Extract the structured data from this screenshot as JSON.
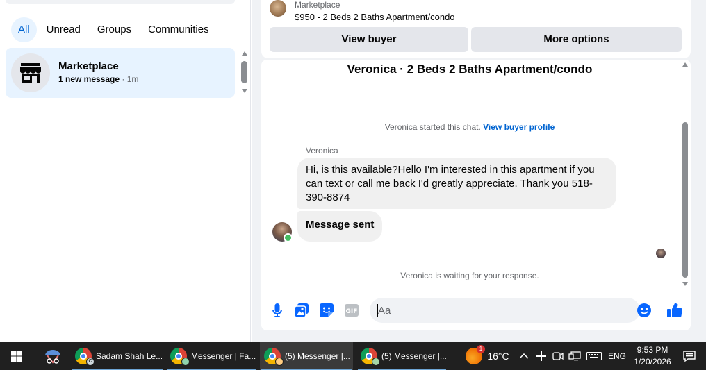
{
  "sidebar": {
    "filters": [
      {
        "label": "All",
        "active": true
      },
      {
        "label": "Unread",
        "active": false
      },
      {
        "label": "Groups",
        "active": false
      },
      {
        "label": "Communities",
        "active": false
      }
    ],
    "chats": [
      {
        "title": "Marketplace",
        "unread": "1 new message",
        "time": " · 1m",
        "icon": "storefront-icon"
      }
    ]
  },
  "listing": {
    "source": "Marketplace",
    "title": "$950 - 2 Beds 2 Baths Apartment/condo",
    "view_buyer": "View buyer",
    "more_options": "More options"
  },
  "conversation": {
    "heading": "Veronica · 2 Beds 2 Baths Apartment/condo",
    "started_text": "Veronica started this chat.",
    "started_link": "View buyer profile",
    "sender": "Veronica",
    "messages": [
      "Hi, is this available?Hello I'm interested in this apartment if you can text or call me back I'd greatly appreciate. Thank you 518-390-8874",
      "Message sent"
    ],
    "waiting": "Veronica is waiting for your response."
  },
  "composer": {
    "placeholder": "Aa",
    "icons": [
      "microphone-icon",
      "photo-icon",
      "sticker-icon",
      "gif-icon",
      "emoji-icon",
      "like-icon"
    ],
    "gif_label": "GIF"
  },
  "taskbar": {
    "apps": [
      {
        "label": "Sadam Shah Le...",
        "badge": "C",
        "active": false
      },
      {
        "label": "Messenger | Fa...",
        "badge": "",
        "active": false
      },
      {
        "label": "(5) Messenger |...",
        "badge": "",
        "active": true
      },
      {
        "label": "(5) Messenger |...",
        "badge": "",
        "active": false
      }
    ],
    "weather_badge": "1",
    "temperature": "16°C",
    "language": "ENG",
    "time": "9:53 PM",
    "date": "1/20/2026"
  },
  "colors": {
    "accent": "#0064d1",
    "messenger_blue": "#0866ff",
    "bubble": "#f0f0f0",
    "panel_bg": "#f0f2f5"
  }
}
